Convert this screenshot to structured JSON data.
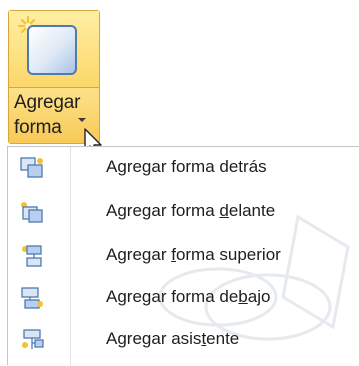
{
  "button": {
    "line1": "Agregar",
    "line2": "forma",
    "icon": "shape-icon",
    "dropdown_icon": "caret-down-icon"
  },
  "menu": {
    "items": [
      {
        "pre": "A",
        "key": "g",
        "post": "regar forma detrás",
        "icon": "shape-behind-icon"
      },
      {
        "pre": "Agregar forma ",
        "key": "d",
        "post": "elante",
        "icon": "shape-ahead-icon"
      },
      {
        "pre": "Agregar ",
        "key": "f",
        "post": "orma superior",
        "icon": "shape-above-icon"
      },
      {
        "pre": "Agregar forma de",
        "key": "b",
        "post": "ajo",
        "icon": "shape-below-icon"
      },
      {
        "pre": "Agregar asis",
        "key": "t",
        "post": "ente",
        "icon": "assistant-icon"
      }
    ]
  },
  "colors": {
    "highlight": "#fcd76a",
    "highlight_border": "#d9a43a",
    "shape_blue": "#4e7bb0"
  }
}
